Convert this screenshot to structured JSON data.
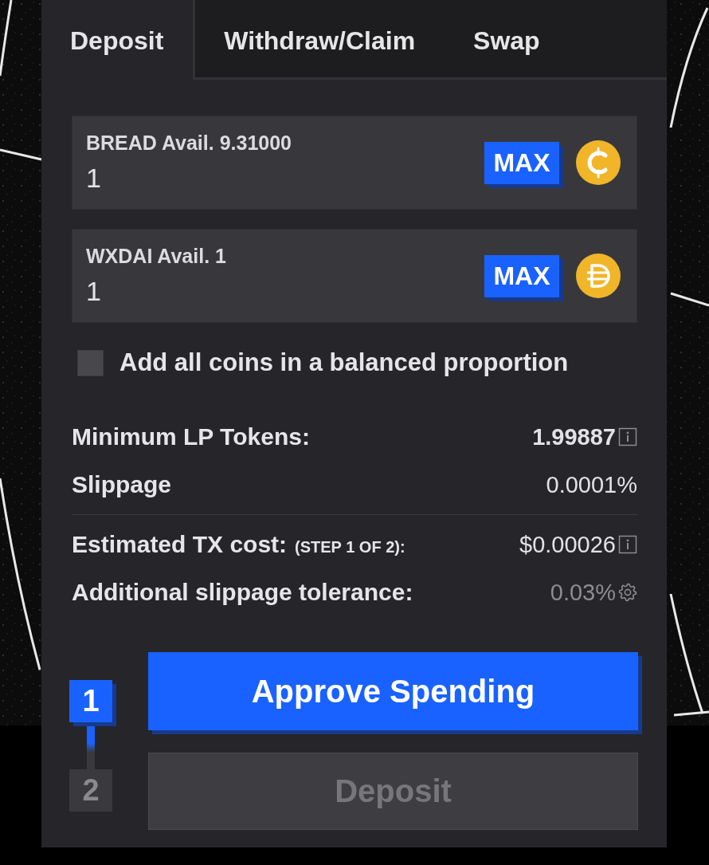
{
  "tabs": [
    {
      "label": "Deposit",
      "selected": true
    },
    {
      "label": "Withdraw/Claim",
      "selected": false
    },
    {
      "label": "Swap",
      "selected": false
    }
  ],
  "token_inputs": [
    {
      "label": "BREAD Avail. 9.31000",
      "value": "1",
      "button": "MAX",
      "kind": "cedi"
    },
    {
      "label": "WXDAI Avail. 1",
      "value": "1",
      "button": "MAX",
      "kind": "dai"
    }
  ],
  "balanced_option": {
    "label": "Add all coins in a balanced proportion",
    "checked": false
  },
  "details": [
    {
      "rows": [
        {
          "label": "Minimum LP Tokens:",
          "value": "1.99887",
          "kind": "total"
        },
        {
          "label": "Slippage",
          "value": "0.0001%",
          "kind": "plain"
        }
      ]
    },
    {
      "rows": [
        {
          "label": "Estimated TX cost:",
          "note": "(STEP 1 OF 2):",
          "value": "$0.00026",
          "kind": "cost"
        },
        {
          "label": "Additional slippage tolerance:",
          "value": "0.03%",
          "kind": "setting"
        }
      ]
    }
  ],
  "steps": [
    {
      "number": "1",
      "button": "Approve Spending",
      "disabled": false
    },
    {
      "number": "2",
      "button": "Deposit",
      "disabled": true
    }
  ]
}
